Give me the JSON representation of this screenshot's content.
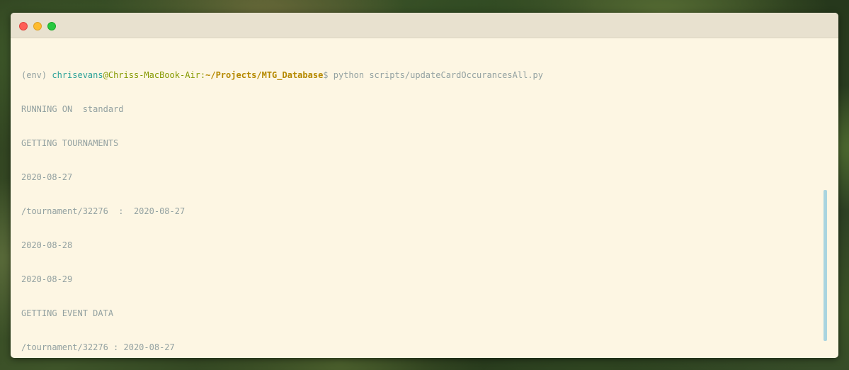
{
  "window": {
    "controls": [
      "close",
      "minimize",
      "zoom"
    ]
  },
  "prompt": {
    "env": "(env) ",
    "user": "chrisevans",
    "at": "@",
    "host": "Chriss-MacBook-Air",
    "colon": ":",
    "path": "~/Projects/MTG_Database",
    "symbol": "$",
    "command": " python scripts/updateCardOccurancesAll.py"
  },
  "output": [
    "RUNNING ON  standard",
    "GETTING TOURNAMENTS",
    "2020-08-27",
    "/tournament/32276  :  2020-08-27",
    "2020-08-28",
    "2020-08-29",
    "GETTING EVENT DATA",
    "/tournament/32276 : 2020-08-27"
  ],
  "colors": {
    "background": "#fdf6e3",
    "text": "#93a1a1",
    "user": "#2aa198",
    "host": "#859900",
    "path": "#b58900",
    "cursor": "#e889b0",
    "scrollbar": "#a9d4df"
  }
}
